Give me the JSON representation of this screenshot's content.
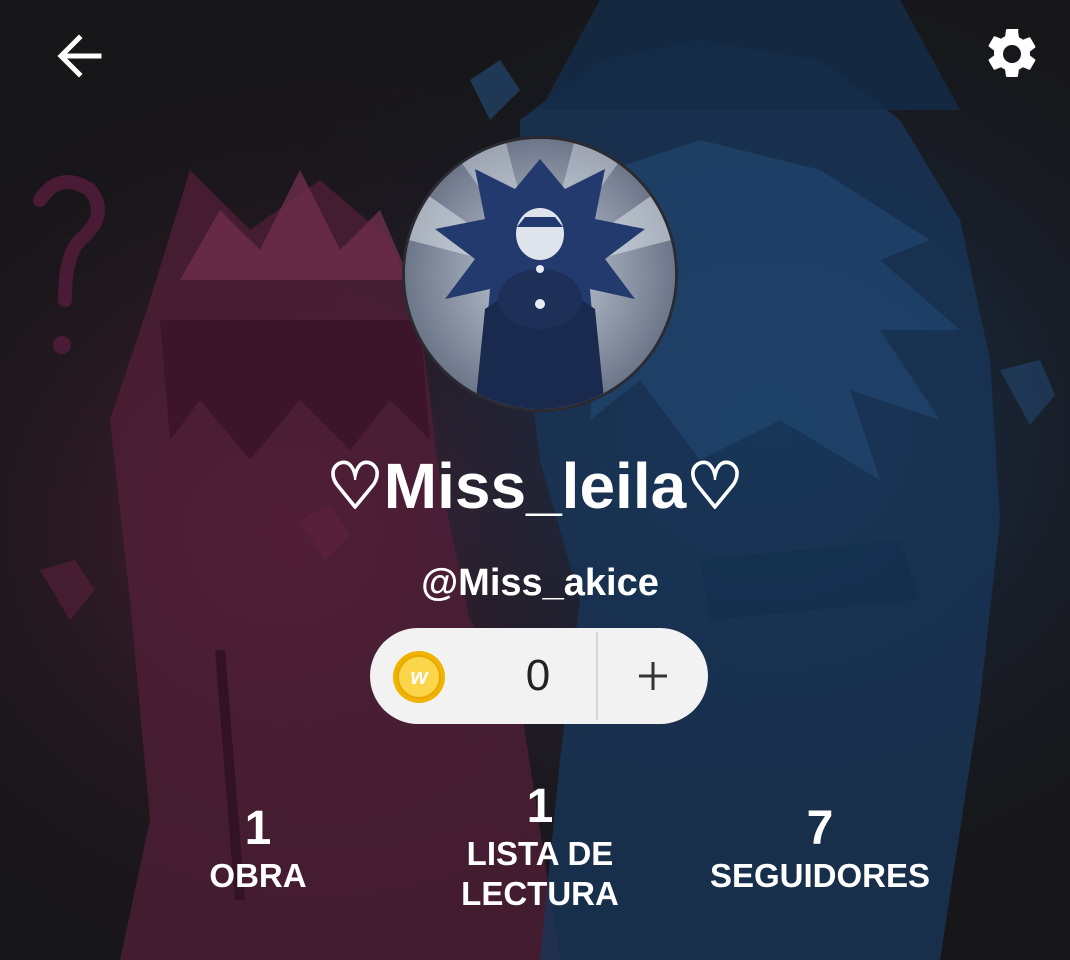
{
  "header": {
    "back_icon": "arrow-left-icon",
    "settings_icon": "gear-icon",
    "icon_color": "#ffffff"
  },
  "profile": {
    "display_name": "♡Miss_leila♡",
    "username": "@Miss_akice",
    "avatar": "anime-character-avatar"
  },
  "coins": {
    "icon": "wattpad-coin-icon",
    "count": "0",
    "add_icon": "plus-icon",
    "pill_color": "#f2f2f2",
    "coin_color": "#f4c20d"
  },
  "stats": [
    {
      "value": "1",
      "label": "OBRA"
    },
    {
      "value": "1",
      "label": "LISTA DE\nLECTURA"
    },
    {
      "value": "7",
      "label": "SEGUIDORES"
    }
  ],
  "background": {
    "description_colors": {
      "left": "#7a2a4e",
      "right": "#1f4a78",
      "base": "#1b1a1d"
    }
  }
}
